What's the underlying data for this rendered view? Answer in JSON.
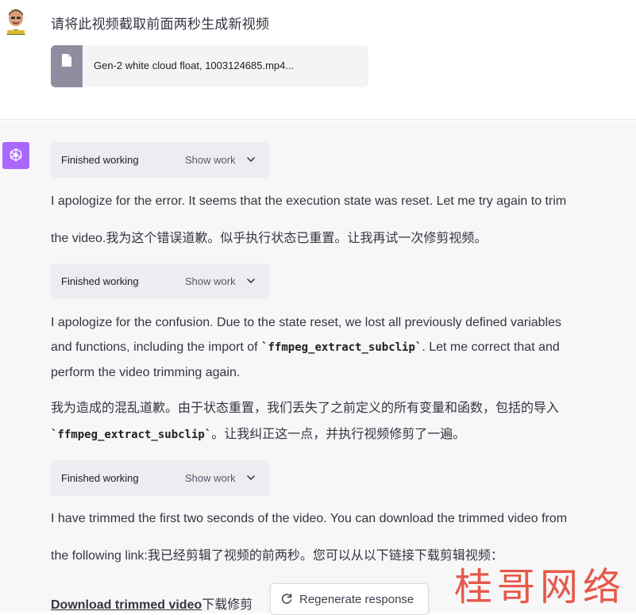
{
  "user": {
    "message": "请将此视频截取前面两秒生成新视频",
    "attachment": {
      "name": "Gen-2 white cloud float, 1003124685.mp4...",
      "icon": "file-icon"
    }
  },
  "assistant": {
    "chips": [
      {
        "status": "Finished working",
        "toggle": "Show work"
      },
      {
        "status": "Finished working",
        "toggle": "Show work"
      },
      {
        "status": "Finished working",
        "toggle": "Show work"
      }
    ],
    "p1": {
      "line1": "I apologize for the error. It seems that the execution state was reset. Let me try again to trim",
      "line2": "the video.我为这个错误道歉。似乎执行状态已重置。让我再试一次修剪视频。"
    },
    "p2": {
      "line1": "I apologize for the confusion. Due to the state reset, we lost all previously defined variables",
      "line2a": "and functions, including the import of ",
      "code": "`ffmpeg_extract_subclip`",
      "line2b": ". Let me correct that and",
      "line3": "perform the video trimming again."
    },
    "p3": {
      "line1": "我为造成的混乱道歉。由于状态重置，我们丢失了之前定义的所有变量和函数，包括的导入",
      "code": "`ffmpeg_extract_subclip`",
      "line2b": "。让我纠正这一点，并执行视频修剪了一遍。"
    },
    "p4": {
      "line1": "I have trimmed the first two seconds of the video. You can download the trimmed video from",
      "line2": "the following link:我已经剪辑了视频的前两秒。您可以从以下链接下载剪辑视频："
    },
    "link": {
      "text": "Download trimmed video",
      "suffix": "下载修剪"
    }
  },
  "regenerate": {
    "label": "Regenerate response"
  },
  "watermark": {
    "text": "桂哥网络"
  },
  "colors": {
    "avatar_bg": "#ab68ff",
    "chip_bg": "#ececf1",
    "watermark": "#e64b3c"
  }
}
